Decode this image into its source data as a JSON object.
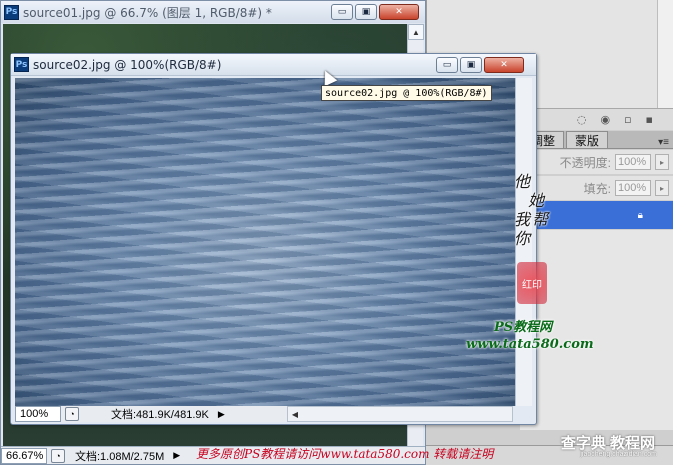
{
  "app": {
    "logo": "Ps"
  },
  "window_back": {
    "title": "source01.jpg @ 66.7% (图层 1, RGB/8#) *",
    "zoom": "66.67%",
    "doc_info": "文档:1.08M/2.75M",
    "controls": {
      "minimize": "▭",
      "restore": "▣",
      "close": "✕"
    }
  },
  "window_front": {
    "title": "source02.jpg @ 100%(RGB/8#)",
    "zoom": "100%",
    "doc_info": "文档:481.9K/481.9K",
    "controls": {
      "minimize": "▭",
      "restore": "▣",
      "close": "✕"
    }
  },
  "tooltip": "source02.jpg @ 100%(RGB/8#)",
  "panels": {
    "tabs": [
      {
        "label": "调整"
      },
      {
        "label": "蒙版"
      }
    ],
    "opacity_label": "不透明度:",
    "opacity_value": "100%",
    "fill_label": "填充:",
    "fill_value": "100%"
  },
  "watermark": {
    "signature": [
      "他",
      "她",
      "我",
      "帮",
      "你"
    ],
    "seal": "红印",
    "ps_net": "PS教程网",
    "url": "www.tata580.com",
    "bottom_banner": "更多原创PS教程请访问www.tata580.com 转载请注明",
    "corner": "查字典 教程网",
    "corner_sub": "jiaocheng.chazidian.com"
  },
  "colors": {
    "selected_layer": "#3a6fd8",
    "close_button": "#c8432c",
    "watermark_green": "#0a6b1a",
    "banner_red": "#c8001e"
  }
}
